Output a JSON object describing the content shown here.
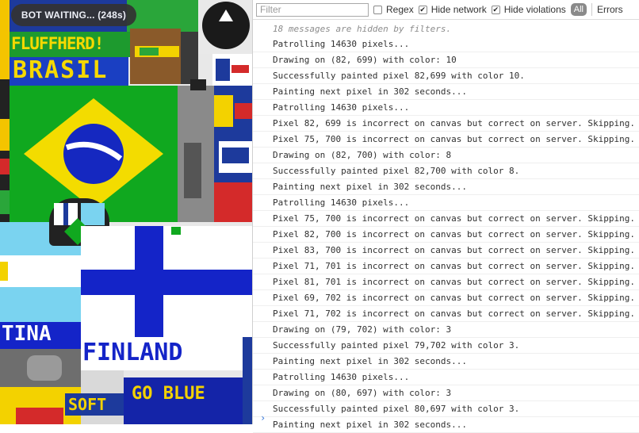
{
  "canvas": {
    "status_pill": "BOT WAITING... (248s)",
    "labels": {
      "fluffherd": "FLUFFHERD!",
      "brasil": "BRASIL",
      "finland": "FINLAND",
      "go_blue": "GO BLUE",
      "tina": "TINA",
      "soft": "SOFT"
    }
  },
  "console": {
    "filter_placeholder": "Filter",
    "regex_label": "Regex",
    "hide_network_label": "Hide network",
    "hide_violations_label": "Hide violations",
    "all_button": "All",
    "errors_label": "Errors",
    "hidden_note": "18 messages are hidden by filters.",
    "prompt_symbol": "›",
    "messages": [
      "Patrolling 14630 pixels...",
      "Drawing on (82, 699) with color: 10",
      "Successfully painted pixel 82,699 with color 10.",
      "Painting next pixel in 302 seconds...",
      "Patrolling 14630 pixels...",
      "Pixel 82, 699 is incorrect on canvas but correct on server. Skipping.",
      "Pixel 75, 700 is incorrect on canvas but correct on server. Skipping.",
      "Drawing on (82, 700) with color: 8",
      "Successfully painted pixel 82,700 with color 8.",
      "Painting next pixel in 302 seconds...",
      "Patrolling 14630 pixels...",
      "Pixel 75, 700 is incorrect on canvas but correct on server. Skipping.",
      "Pixel 82, 700 is incorrect on canvas but correct on server. Skipping.",
      "Pixel 83, 700 is incorrect on canvas but correct on server. Skipping.",
      "Pixel 71, 701 is incorrect on canvas but correct on server. Skipping.",
      "Pixel 81, 701 is incorrect on canvas but correct on server. Skipping.",
      "Pixel 69, 702 is incorrect on canvas but correct on server. Skipping.",
      "Pixel 71, 702 is incorrect on canvas but correct on server. Skipping.",
      "Drawing on (79, 702) with color: 3",
      "Successfully painted pixel 79,702 with color 3.",
      "Painting next pixel in 302 seconds...",
      "Patrolling 14630 pixels...",
      "Drawing on (80, 697) with color: 3",
      "Successfully painted pixel 80,697 with color 3.",
      "Painting next pixel in 302 seconds..."
    ]
  }
}
